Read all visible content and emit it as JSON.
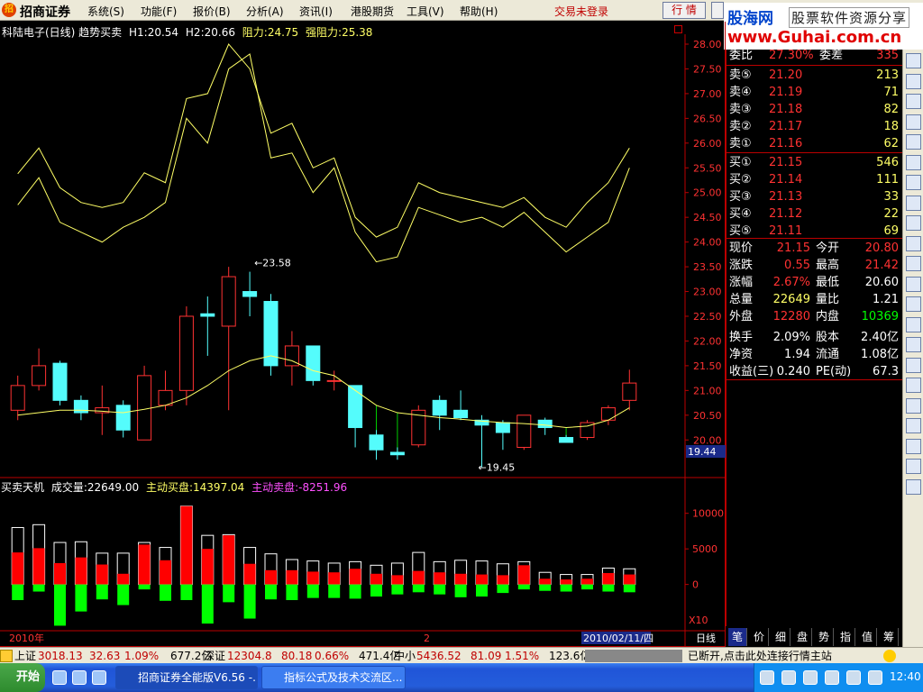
{
  "menubar": {
    "logo_glyph": "招",
    "app_name": "招商证券",
    "items": [
      "系统(S)",
      "功能(F)",
      "报价(B)",
      "分析(A)",
      "资讯(I)",
      "港股期货",
      "工具(V)",
      "帮助(H)"
    ],
    "trade_status": "交易未登录",
    "quote_button": "行 情"
  },
  "watermark": {
    "site": "股海网",
    "tagline": "股票软件资源分享",
    "url": "www.Guhai.com.cn"
  },
  "chart": {
    "title": "科陆电子(日线) 趋势买卖",
    "h1": "H1:20.54",
    "h2": "H2:20.66",
    "resist": "阻力:24.75",
    "strong_resist": "强阻力:25.38",
    "current_price_box": "19.44",
    "year_label": "2010年",
    "mid_label": "2",
    "date_label": "2010/02/11/四",
    "period_tab": "日线",
    "x10": "X10"
  },
  "volume": {
    "title": "买卖天机",
    "volume": "成交量:22649.00",
    "buy": "主动买盘:14397.04",
    "sell": "主动卖盘:-8251.96"
  },
  "colors": {
    "up": "#ff3232",
    "down": "#54fcfc",
    "ma": "#ffff66",
    "buy": "#ff0000",
    "sell": "#00ff00",
    "magenta": "#ff50ff"
  },
  "chart_data": {
    "type": "candlestick",
    "ylim": [
      19.44,
      28.0
    ],
    "yticks": [
      28.0,
      27.5,
      27.0,
      26.5,
      26.0,
      25.5,
      25.0,
      24.5,
      24.0,
      23.5,
      23.0,
      22.5,
      22.0,
      21.5,
      21.0,
      20.5,
      20.0
    ],
    "annotations": [
      {
        "text": "23.58",
        "value": 23.58
      },
      {
        "text": "19.45",
        "value": 19.45
      }
    ],
    "candles": [
      {
        "o": 20.6,
        "h": 21.3,
        "l": 20.4,
        "c": 21.1
      },
      {
        "o": 21.1,
        "h": 21.85,
        "l": 21.0,
        "c": 21.5
      },
      {
        "o": 21.55,
        "h": 21.6,
        "l": 20.7,
        "c": 20.8
      },
      {
        "o": 20.8,
        "h": 20.9,
        "l": 20.4,
        "c": 20.55
      },
      {
        "o": 20.55,
        "h": 21.1,
        "l": 20.1,
        "c": 20.65
      },
      {
        "o": 20.7,
        "h": 20.8,
        "l": 20.05,
        "c": 20.2
      },
      {
        "o": 20.0,
        "h": 21.5,
        "l": 20.0,
        "c": 21.3
      },
      {
        "o": 20.7,
        "h": 21.4,
        "l": 20.6,
        "c": 21.0
      },
      {
        "o": 21.0,
        "h": 22.7,
        "l": 20.7,
        "c": 22.5
      },
      {
        "o": 22.55,
        "h": 22.9,
        "l": 21.7,
        "c": 22.5
      },
      {
        "o": 22.3,
        "h": 23.5,
        "l": 20.6,
        "c": 23.3
      },
      {
        "o": 23.0,
        "h": 23.4,
        "l": 22.5,
        "c": 22.9
      },
      {
        "o": 22.8,
        "h": 22.95,
        "l": 21.3,
        "c": 21.5
      },
      {
        "o": 21.5,
        "h": 22.2,
        "l": 21.1,
        "c": 21.9
      },
      {
        "o": 21.9,
        "h": 21.9,
        "l": 21.1,
        "c": 21.2
      },
      {
        "o": 21.2,
        "h": 21.4,
        "l": 21.0,
        "c": 21.2
      },
      {
        "o": 21.1,
        "h": 21.1,
        "l": 19.85,
        "c": 20.25
      },
      {
        "o": 20.1,
        "h": 20.2,
        "l": 19.6,
        "c": 19.8
      },
      {
        "o": 19.75,
        "h": 19.85,
        "l": 19.6,
        "c": 19.7
      },
      {
        "o": 19.9,
        "h": 20.7,
        "l": 19.85,
        "c": 20.6
      },
      {
        "o": 20.8,
        "h": 20.9,
        "l": 20.2,
        "c": 20.5
      },
      {
        "o": 20.6,
        "h": 21.0,
        "l": 20.4,
        "c": 20.45
      },
      {
        "o": 20.4,
        "h": 20.5,
        "l": 19.45,
        "c": 20.3
      },
      {
        "o": 20.35,
        "h": 20.4,
        "l": 19.8,
        "c": 20.15
      },
      {
        "o": 19.85,
        "h": 20.5,
        "l": 19.8,
        "c": 20.5
      },
      {
        "o": 20.4,
        "h": 20.45,
        "l": 20.1,
        "c": 20.25
      },
      {
        "o": 20.05,
        "h": 20.1,
        "l": 19.95,
        "c": 19.95
      },
      {
        "o": 20.05,
        "h": 20.4,
        "l": 20.0,
        "c": 20.35
      },
      {
        "o": 20.4,
        "h": 20.7,
        "l": 20.3,
        "c": 20.65
      },
      {
        "o": 20.8,
        "h": 21.42,
        "l": 20.6,
        "c": 21.15
      }
    ],
    "ma": [
      20.5,
      20.55,
      20.6,
      20.6,
      20.58,
      20.55,
      20.62,
      20.7,
      20.85,
      21.1,
      21.4,
      21.6,
      21.7,
      21.6,
      21.4,
      21.3,
      21.0,
      20.7,
      20.55,
      20.5,
      20.45,
      20.42,
      20.38,
      20.35,
      20.33,
      20.3,
      20.25,
      20.28,
      20.4,
      20.65
    ],
    "resist": [
      24.75,
      25.3,
      24.4,
      24.2,
      24.0,
      24.3,
      24.5,
      24.8,
      26.5,
      26.0,
      27.5,
      27.8,
      25.7,
      25.8,
      25.0,
      25.5,
      24.2,
      23.6,
      23.7,
      24.7,
      24.55,
      24.4,
      24.5,
      24.3,
      24.6,
      24.2,
      23.8,
      24.1,
      24.4,
      25.5
    ],
    "strong_resist": [
      25.38,
      25.9,
      25.1,
      24.8,
      24.7,
      24.8,
      25.4,
      25.2,
      26.9,
      27.0,
      28.0,
      27.5,
      26.2,
      26.4,
      25.5,
      25.7,
      24.5,
      24.1,
      24.3,
      25.2,
      25.0,
      24.9,
      24.8,
      24.7,
      24.9,
      24.5,
      24.3,
      24.8,
      25.2,
      25.9
    ],
    "vol_ylim": [
      -6000,
      13000
    ],
    "vol_yticks": [
      10000,
      5000,
      0
    ],
    "buy": [
      4500,
      5100,
      3000,
      3800,
      2800,
      1500,
      5600,
      3400,
      11000,
      5000,
      6900,
      2900,
      2000,
      2000,
      1800,
      1700,
      2200,
      1500,
      1300,
      1900,
      1700,
      1500,
      1400,
      1300,
      2700,
      800,
      700,
      800,
      1600,
      1400
    ],
    "sell": [
      -2200,
      -1000,
      -5800,
      -3800,
      -2100,
      -2900,
      -700,
      -2300,
      -2200,
      -5500,
      -2500,
      -4800,
      -2100,
      -2200,
      -1900,
      -1900,
      -2000,
      -1700,
      -1400,
      -1100,
      -1400,
      -1800,
      -1700,
      -1200,
      -700,
      -900,
      -1000,
      -700,
      -1000,
      -1100
    ],
    "vol_total": [
      8000,
      8400,
      5900,
      6000,
      4400,
      4400,
      5900,
      5200,
      11000,
      6900,
      7000,
      5200,
      4300,
      3500,
      3300,
      3000,
      3200,
      2700,
      3000,
      4500,
      3200,
      3400,
      3300,
      2900,
      3200,
      1700,
      1400,
      1400,
      2300,
      2200
    ]
  },
  "quotes": {
    "ratio_label": "委比",
    "ratio_value": "27.30%",
    "diff_label": "委差",
    "diff_value": "335",
    "sells": [
      {
        "label": "卖⑤",
        "price": "21.20",
        "vol": "213"
      },
      {
        "label": "卖④",
        "price": "21.19",
        "vol": "71"
      },
      {
        "label": "卖③",
        "price": "21.18",
        "vol": "82"
      },
      {
        "label": "卖②",
        "price": "21.17",
        "vol": "18"
      },
      {
        "label": "卖①",
        "price": "21.16",
        "vol": "62"
      }
    ],
    "buys": [
      {
        "label": "买①",
        "price": "21.15",
        "vol": "546"
      },
      {
        "label": "买②",
        "price": "21.14",
        "vol": "111"
      },
      {
        "label": "买③",
        "price": "21.13",
        "vol": "33"
      },
      {
        "label": "买④",
        "price": "21.12",
        "vol": "22"
      },
      {
        "label": "买⑤",
        "price": "21.11",
        "vol": "69"
      }
    ],
    "stats": [
      {
        "l1": "现价",
        "v1": "21.15",
        "c1": "#ff3232",
        "l2": "今开",
        "v2": "20.80",
        "c2": "#ff3232"
      },
      {
        "l1": "涨跌",
        "v1": "0.55",
        "c1": "#ff3232",
        "l2": "最高",
        "v2": "21.42",
        "c2": "#ff3232"
      },
      {
        "l1": "涨幅",
        "v1": "2.67%",
        "c1": "#ff3232",
        "l2": "最低",
        "v2": "20.60",
        "c2": "#ffffff"
      },
      {
        "l1": "总量",
        "v1": "22649",
        "c1": "#ffff66",
        "l2": "量比",
        "v2": "1.21",
        "c2": "#ffffff"
      },
      {
        "l1": "外盘",
        "v1": "12280",
        "c1": "#ff3232",
        "l2": "内盘",
        "v2": "10369",
        "c2": "#00ff00"
      },
      {
        "l1": "换手",
        "v1": "2.09%",
        "c1": "#ffffff",
        "l2": "股本",
        "v2": "2.40亿",
        "c2": "#ffffff"
      },
      {
        "l1": "净资",
        "v1": "1.94",
        "c1": "#ffffff",
        "l2": "流通",
        "v2": "1.08亿",
        "c2": "#ffffff"
      },
      {
        "l1": "收益(三)",
        "v1": "0.240",
        "c1": "#ffffff",
        "l2": "PE(动)",
        "v2": "67.3",
        "c2": "#ffffff"
      }
    ]
  },
  "bottom_tabs": [
    "笔",
    "价",
    "细",
    "盘",
    "势",
    "指",
    "值",
    "筹"
  ],
  "right_toolbar": [
    "chart-line-icon",
    "chart-bar-icon",
    "chart-kline-icon",
    "grid-icon",
    "list-icon",
    "news-icon",
    "table-icon",
    "doc-icon",
    "etf-icon",
    "people-icon",
    "dollar-icon",
    "line-icon",
    "macd-icon",
    "rsi-icon",
    "kdj-icon",
    "cci-icon",
    "search-icon",
    "import-icon",
    "export-icon",
    "move-icon",
    "up-arrow-icon",
    "down-arrow-icon"
  ],
  "statusbar": {
    "sh_label": "上证",
    "sh_value": "3018.13",
    "sh_change": "32.63",
    "sh_pct": "1.09%",
    "sh_amount": "677.2亿",
    "sz_label": "深证",
    "sz_value": "12304.8",
    "sz_change": "80.18",
    "sz_pct": "0.66%",
    "sz_amount": "471.4亿",
    "zx_label": "中小",
    "zx_value": "5436.52",
    "zx_change": "81.09",
    "zx_pct": "1.51%",
    "zx_amount": "123.6亿",
    "message": "已断开,点击此处连接行情主站"
  },
  "taskbar": {
    "start": "开始",
    "tasks": [
      "招商证券全能版V6.56 -...",
      "指标公式及技术交流区..."
    ],
    "clock": "12:40"
  }
}
